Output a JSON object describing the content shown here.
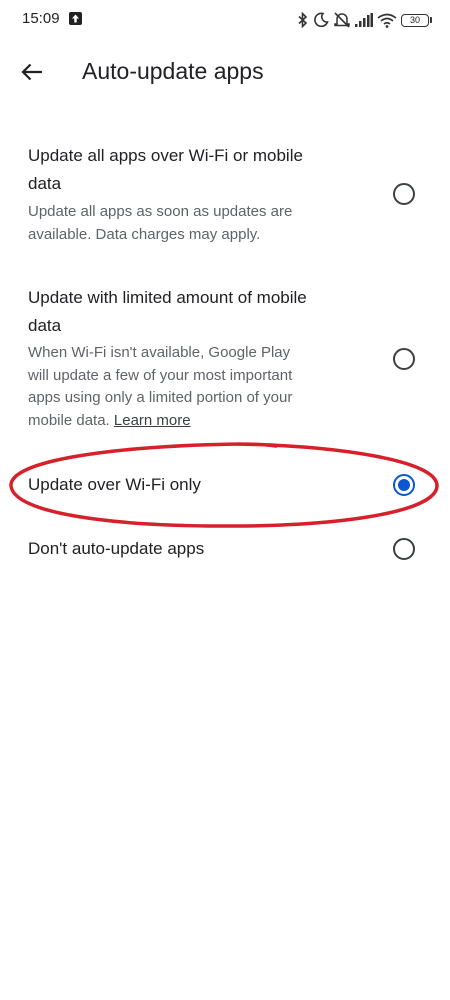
{
  "status_bar": {
    "time": "15:09",
    "battery": "30",
    "icons": [
      "upload-icon",
      "bluetooth-icon",
      "moon-icon",
      "muted-bell-icon",
      "signal-icon",
      "wifi-icon",
      "battery-icon"
    ]
  },
  "app_bar": {
    "title": "Auto-update apps",
    "back_icon": "arrow-left-icon"
  },
  "options": [
    {
      "title_line1": "Update all apps over Wi-Fi or mobile",
      "title_line2": "data",
      "desc_line1": "Update all apps as soon as updates are",
      "desc_line2": "available. Data charges may apply.",
      "selected": false
    },
    {
      "title_line1": "Update with limited amount of mobile",
      "title_line2": "data",
      "desc_line1": "When Wi-Fi isn't available, Google Play",
      "desc_line2": "will update a few of your most important",
      "desc_line3": "apps using only a limited portion of your",
      "desc_line4": "mobile data.",
      "learn_more": "Learn more",
      "selected": false
    },
    {
      "title": "Update over Wi-Fi only",
      "selected": true
    },
    {
      "title": "Don't auto-update apps",
      "selected": false
    }
  ],
  "colors": {
    "accent": "#0b57d0",
    "annotation": "#d6202a",
    "text_primary": "#202124",
    "text_secondary": "#5f6368"
  }
}
